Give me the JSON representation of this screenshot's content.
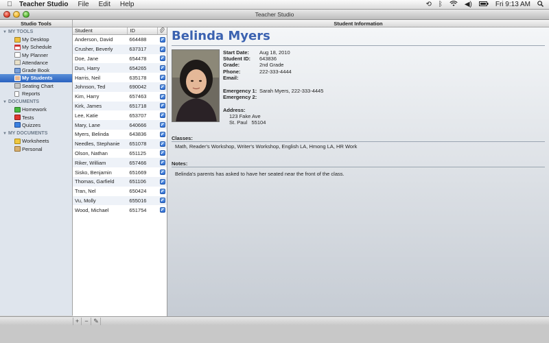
{
  "menubar": {
    "app_name": "Teacher Studio",
    "menus": [
      "File",
      "Edit",
      "Help"
    ],
    "clock": "Fri 9:13 AM"
  },
  "window": {
    "title": "Teacher Studio"
  },
  "headers": {
    "left": "Studio Tools",
    "right": "Student Information"
  },
  "sidebar": {
    "sections": [
      {
        "label": "MY TOOLS",
        "items": [
          "My Desktop",
          "My Schedule",
          "My Planner",
          "Attendance",
          "Grade Book",
          "My Students",
          "Seating Chart",
          "Reports"
        ]
      },
      {
        "label": "DOCUMENTS",
        "items": [
          "Homework",
          "Tests",
          "Quizzes"
        ]
      },
      {
        "label": "MY DOCUMENTS",
        "items": [
          "Worksheets",
          "Personal"
        ]
      }
    ],
    "selected": "My Students"
  },
  "student_list": {
    "columns": [
      "Student",
      "ID"
    ],
    "rows": [
      {
        "name": "Anderson, David",
        "id": "664488"
      },
      {
        "name": "Crusher, Beverly",
        "id": "637317"
      },
      {
        "name": "Doe, Jane",
        "id": "654478"
      },
      {
        "name": "Dun, Harry",
        "id": "654265"
      },
      {
        "name": "Harris, Neil",
        "id": "635178"
      },
      {
        "name": "Johnson, Ted",
        "id": "690042"
      },
      {
        "name": "Kim, Harry",
        "id": "657463"
      },
      {
        "name": "Kirk, James",
        "id": "651718"
      },
      {
        "name": "Lee, Katie",
        "id": "653707"
      },
      {
        "name": "Mary, Lane",
        "id": "640666"
      },
      {
        "name": "Myers, Belinda",
        "id": "643836"
      },
      {
        "name": "Needles, Stephanie",
        "id": "651078"
      },
      {
        "name": "Olson, Nathan",
        "id": "651125"
      },
      {
        "name": "Riker, William",
        "id": "657466"
      },
      {
        "name": "Sisko, Benjamin",
        "id": "651669"
      },
      {
        "name": "Thomas, Garfield",
        "id": "651106"
      },
      {
        "name": "Tran, Nel",
        "id": "650424"
      },
      {
        "name": "Vu, Molly",
        "id": "655016"
      },
      {
        "name": "Wood, Michael",
        "id": "651754"
      }
    ]
  },
  "student": {
    "name": "Belinda Myers",
    "start_date_label": "Start Date:",
    "start_date": "Aug 18, 2010",
    "student_id_label": "Student ID:",
    "student_id": "643836",
    "grade_label": "Grade:",
    "grade": "2nd Grade",
    "phone_label": "Phone:",
    "phone": "222-333-4444",
    "email_label": "Email:",
    "emergency1_label": "Emergency 1:",
    "emergency1": "Sarah Myers, 222-333-4445",
    "emergency2_label": "Emergency 2:",
    "address_label": "Address:",
    "address_line1": "123 Fake Ave",
    "address_line2": "St. Paul   55104",
    "classes_label": "Classes:",
    "classes": "Math, Reader's Workshop, Writer's Workshop, English LA, Hmong LA, HR Work",
    "notes_label": "Notes:",
    "notes": "Belinda's parents has asked to have her seated near the front of the class."
  },
  "colors": {
    "selection": "#2a62c0",
    "name_heading": "#3b62b0",
    "sidebar_bg": "#dfe5ed"
  },
  "icons": {
    "add": "+",
    "remove": "−",
    "edit": "✎"
  }
}
